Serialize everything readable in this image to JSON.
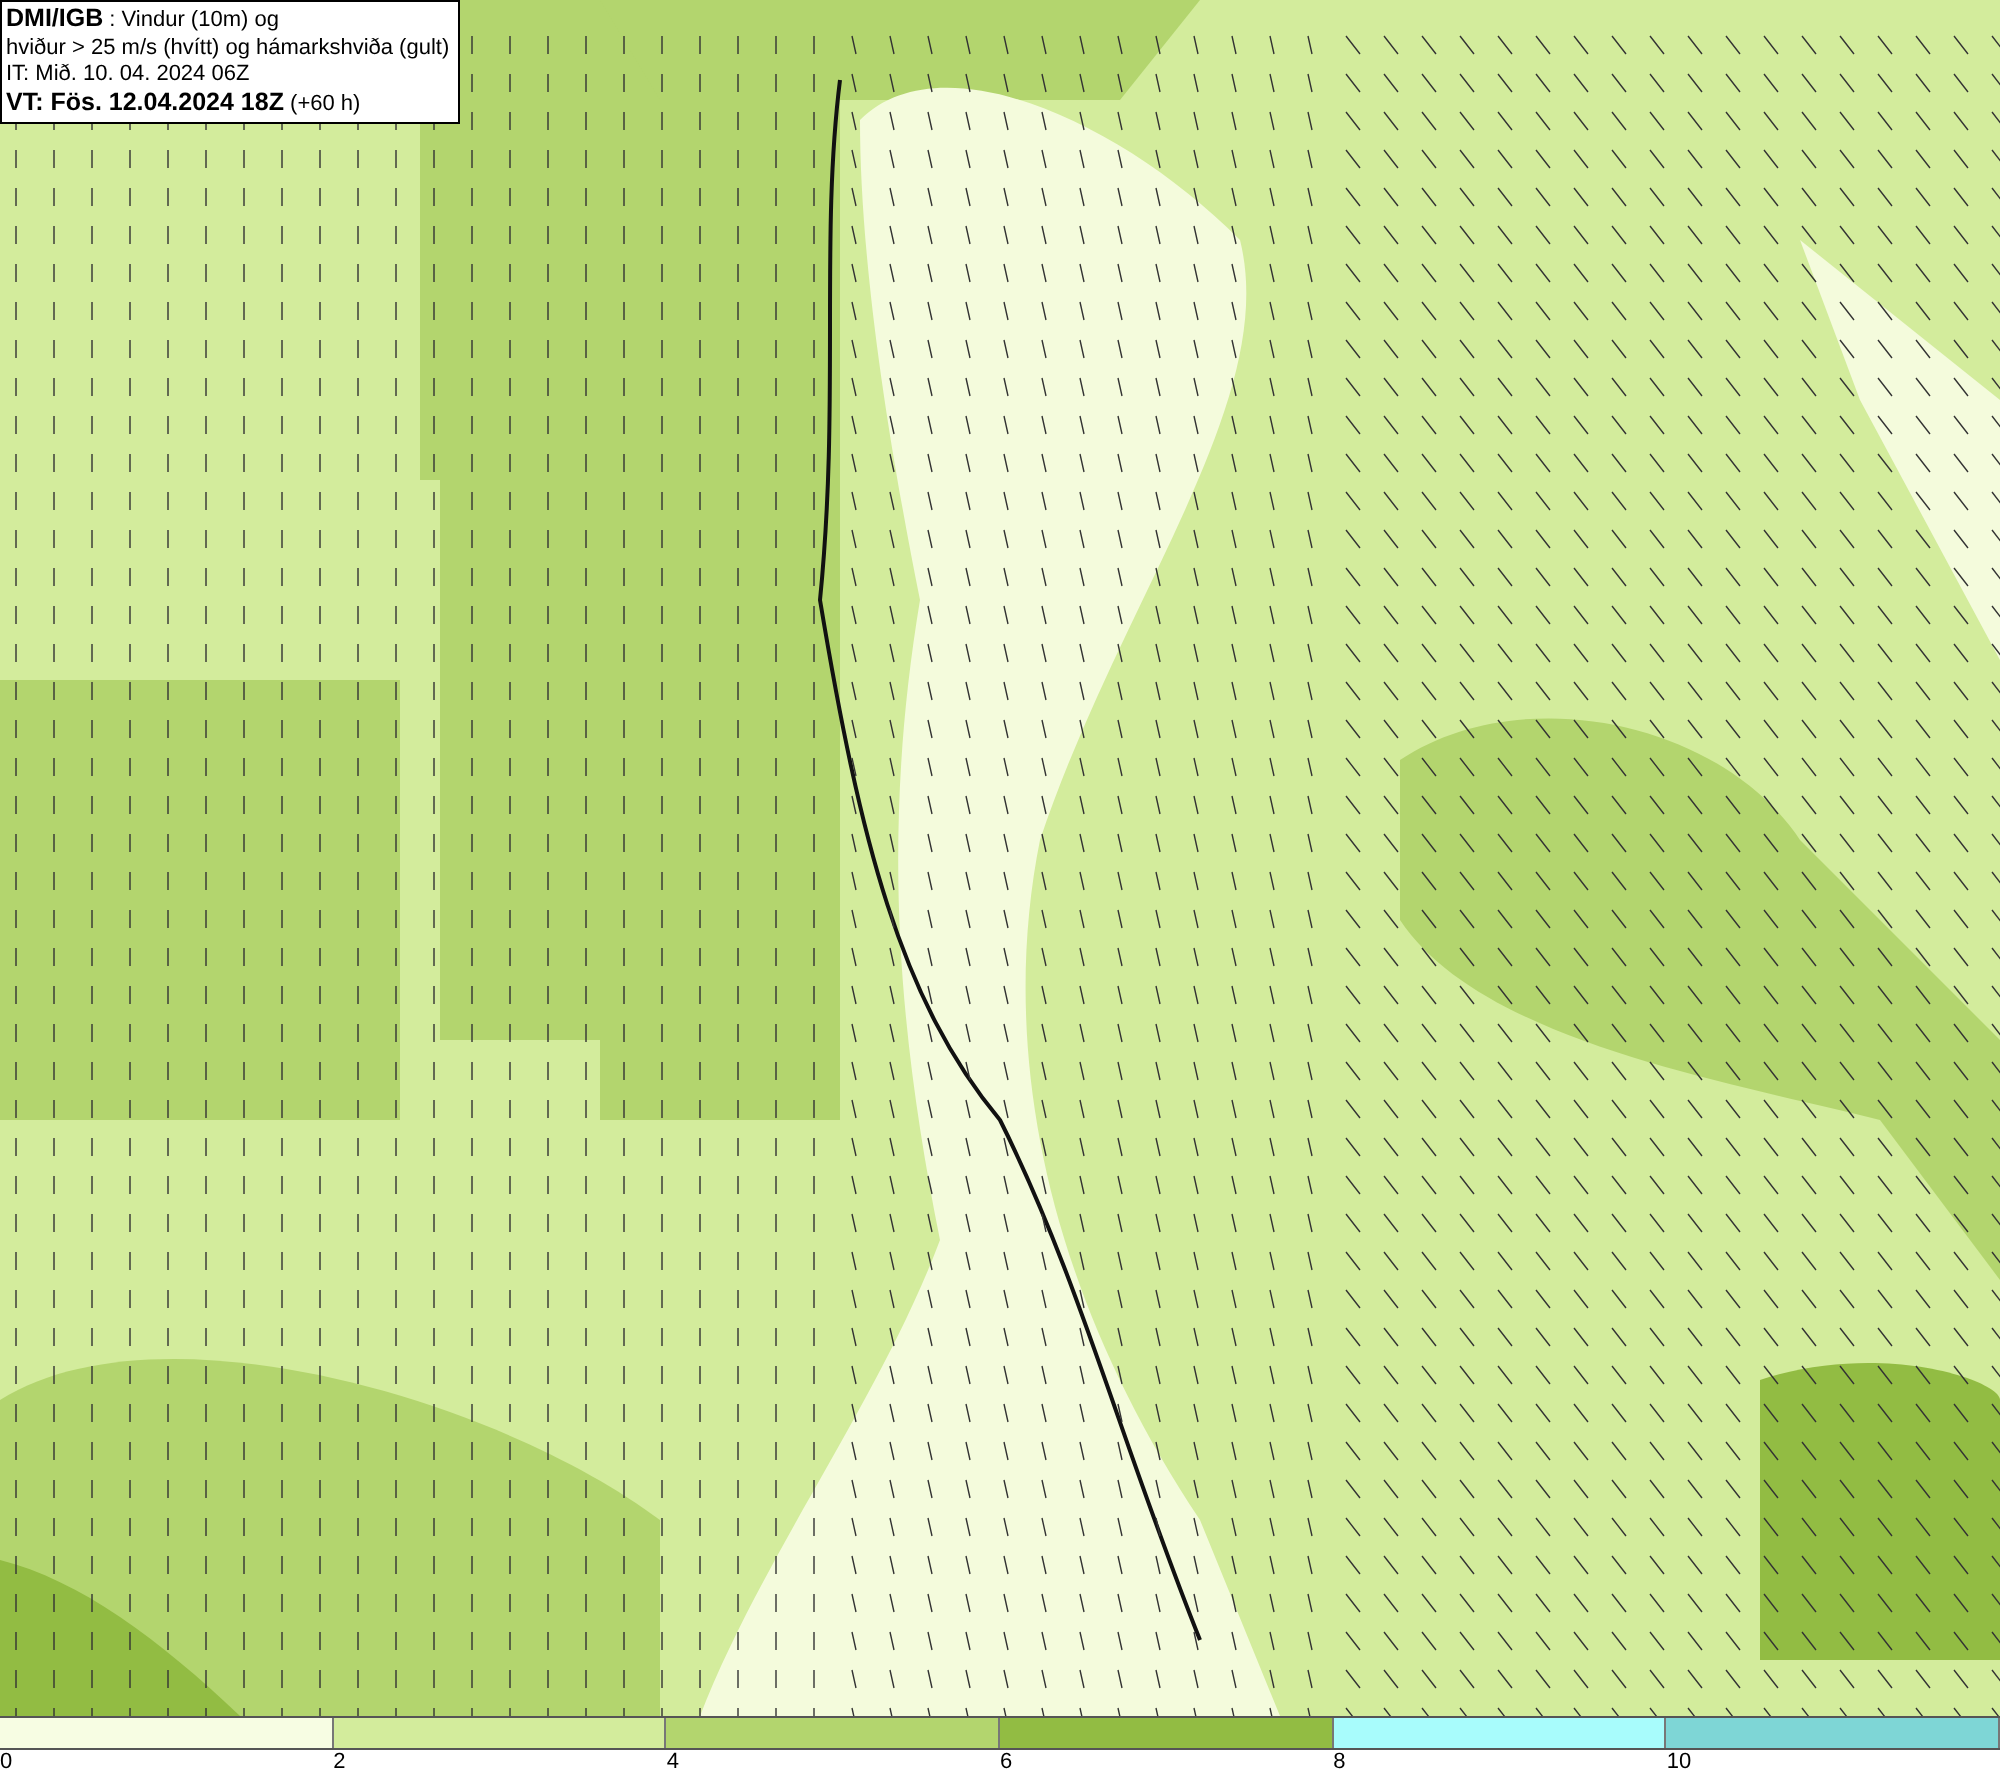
{
  "info_box": {
    "lines": [
      "**DMI/IGB** : Vindur (10m) og",
      "hviður > 25 m/s (hvítt) og hámarkshviða (gult)",
      "IT: Mið. 10. 04. 2024 06Z",
      "**VT: Fös. 12.04.2024 18Z** (+60 h)"
    ]
  },
  "legend": {
    "segments": [
      {
        "color": "#f7fde3"
      },
      {
        "color": "#d3ec9c"
      },
      {
        "color": "#b3d56e"
      },
      {
        "color": "#92bc43"
      },
      {
        "color": "#a8fcfc"
      },
      {
        "color": "#7ed6d6"
      }
    ],
    "ticks": [
      "0",
      "2",
      "4",
      "6",
      "8",
      "10"
    ]
  }
}
